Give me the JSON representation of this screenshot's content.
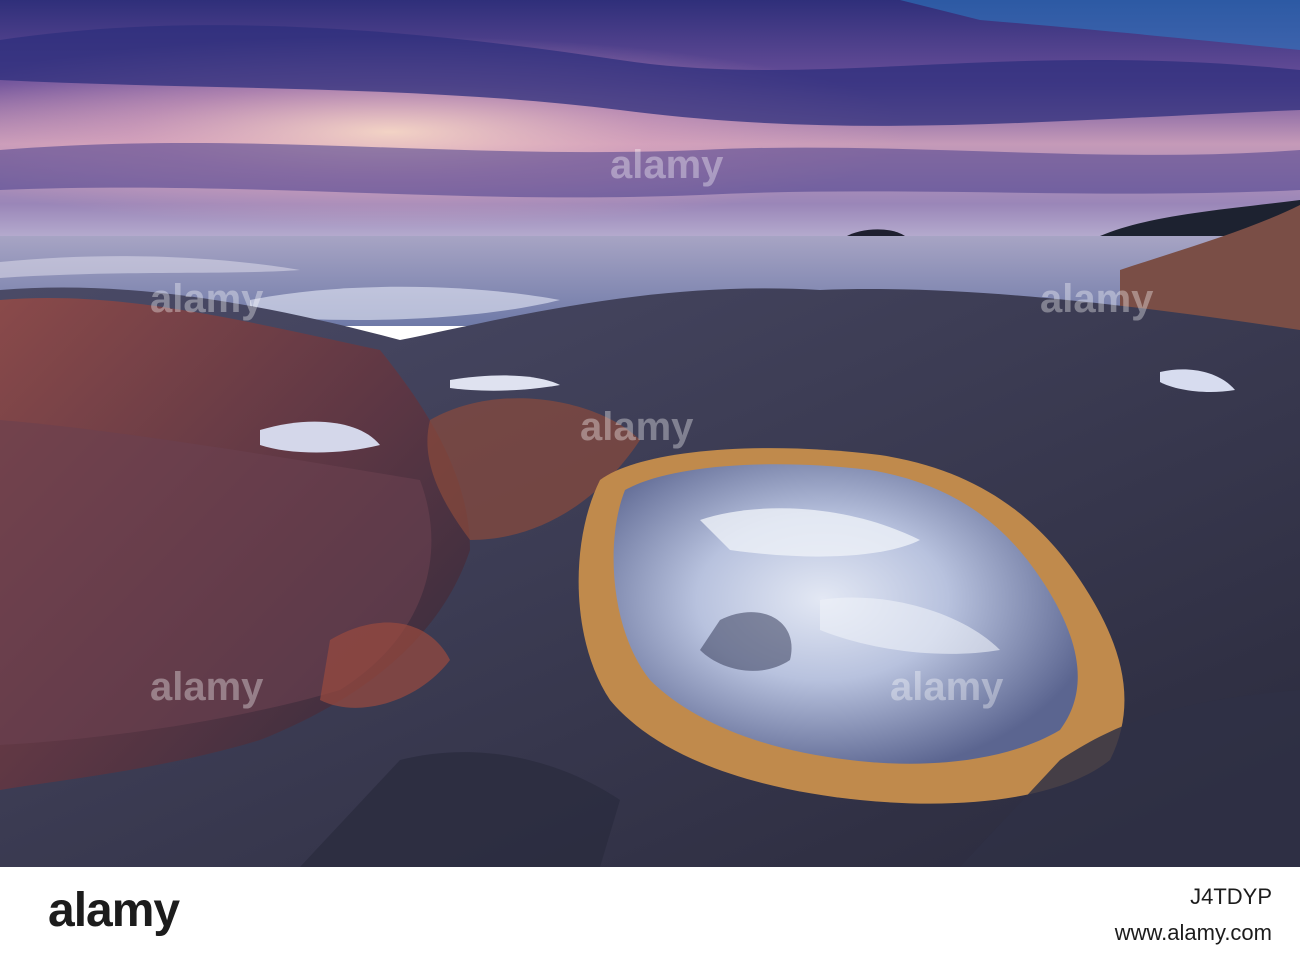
{
  "photo": {
    "subject": "rock-pool-seascape",
    "colors": {
      "sky_top": "#3d3f8f",
      "sky_glow": "#e9b6c0",
      "sea": "#8f93b8",
      "rock_dark": "#3a3447",
      "rock_red": "#7a3f3c",
      "pool_reflection": "#c9d3ea",
      "seaweed": "#c89a52"
    }
  },
  "watermark": {
    "text": "alamy",
    "repeat_label": "a"
  },
  "footer": {
    "logo": "alamy",
    "image_id": "J4TDYP",
    "url": "www.alamy.com"
  }
}
